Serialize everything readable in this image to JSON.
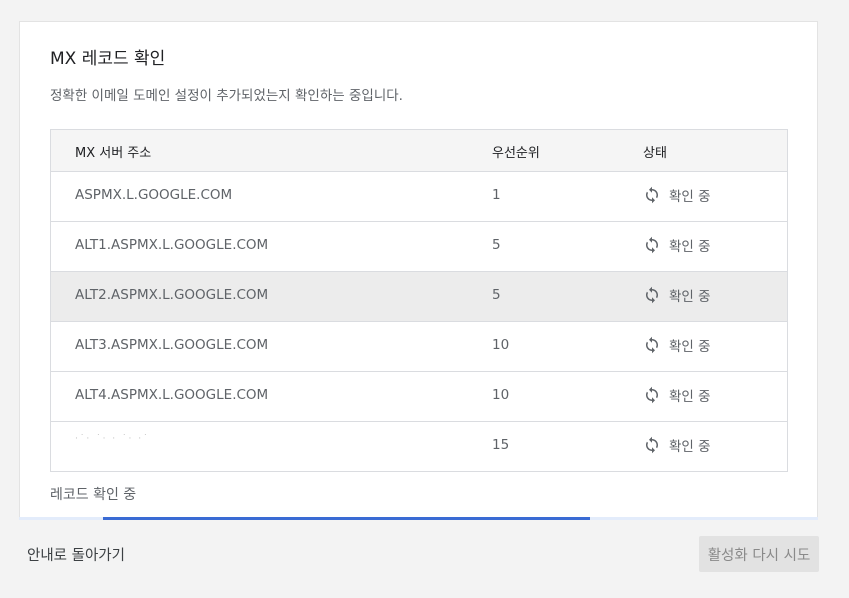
{
  "card": {
    "title": "MX 레코드 확인",
    "subtitle": "정확한 이메일 도메인 설정이 추가되었는지 확인하는 중입니다."
  },
  "table": {
    "headers": {
      "server": "MX 서버 주소",
      "priority": "우선순위",
      "status": "상태"
    },
    "rows": [
      {
        "server": "ASPMX.L.GOOGLE.COM",
        "priority": "1",
        "status": "확인 중"
      },
      {
        "server": "ALT1.ASPMX.L.GOOGLE.COM",
        "priority": "5",
        "status": "확인 중"
      },
      {
        "server": "ALT2.ASPMX.L.GOOGLE.COM",
        "priority": "5",
        "status": "확인 중"
      },
      {
        "server": "ALT3.ASPMX.L.GOOGLE.COM",
        "priority": "10",
        "status": "확인 중"
      },
      {
        "server": "ALT4.ASPMX.L.GOOGLE.COM",
        "priority": "10",
        "status": "확인 중"
      },
      {
        "server": "",
        "priority": "15",
        "status": "확인 중"
      }
    ]
  },
  "status_text": "레코드 확인 중",
  "progress": {
    "start_fraction": 0.105,
    "end_fraction": 0.714,
    "color": "#3a6bd4"
  },
  "footer": {
    "back_label": "안내로 돌아가기",
    "retry_label": "활성화 다시 시도"
  },
  "icons": {
    "status_icon": "refresh-icon"
  }
}
